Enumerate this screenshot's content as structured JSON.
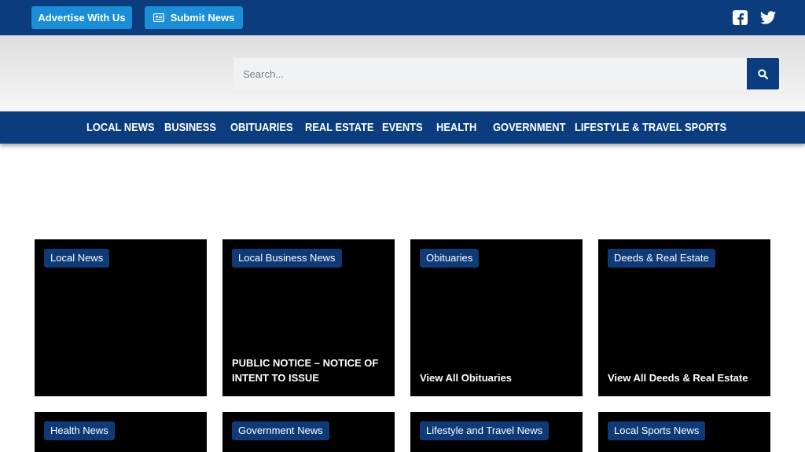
{
  "topbar": {
    "advertise_label": "Advertise With Us",
    "submit_label": "Submit News",
    "social": [
      "facebook-icon",
      "twitter-icon"
    ]
  },
  "search": {
    "placeholder": "Search...",
    "value": ""
  },
  "nav": {
    "items": [
      "LOCAL NEWS",
      "BUSINESS",
      "OBITUARIES",
      "REAL ESTATE",
      "EVENTS",
      "HEALTH",
      "GOVERNMENT",
      "LIFESTYLE & TRAVEL",
      "SPORTS"
    ]
  },
  "cards": [
    {
      "tag": "Local News",
      "title": ""
    },
    {
      "tag": "Local Business News",
      "title": "PUBLIC NOTICE – NOTICE OF INTENT TO ISSUE"
    },
    {
      "tag": "Obituaries",
      "title": "View All Obituaries"
    },
    {
      "tag": "Deeds & Real Estate",
      "title": "View All Deeds & Real Estate"
    },
    {
      "tag": "Health News",
      "title": ""
    },
    {
      "tag": "Government News",
      "title": ""
    },
    {
      "tag": "Lifestyle and Travel News",
      "title": ""
    },
    {
      "tag": "Local Sports News",
      "title": ""
    }
  ],
  "colors": {
    "brand_navy": "#0b3d7e",
    "button_blue": "#1a8fd8",
    "tag_bg": "#0f3a78",
    "card_bg": "#000000"
  }
}
